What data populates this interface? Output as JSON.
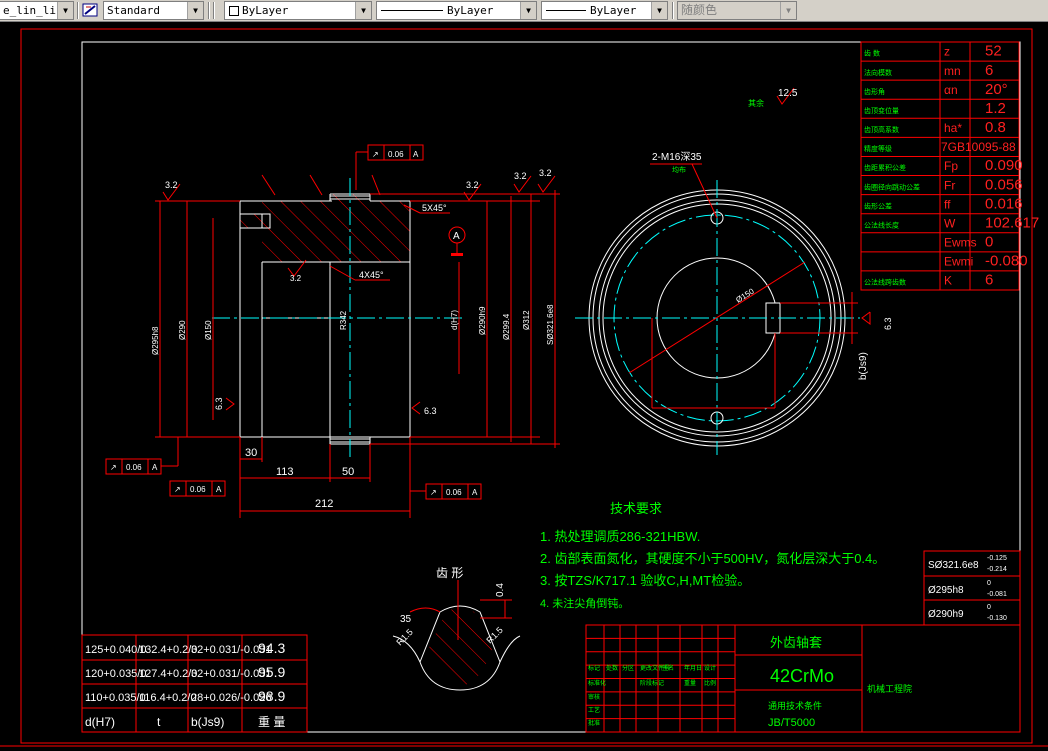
{
  "toolbar": {
    "layer_combo": "e_lin_lin",
    "textstyle_combo": "Standard",
    "color_combo": "ByLayer",
    "linetype_combo": "ByLayer",
    "lineweight_combo": "ByLayer",
    "plotstyle_combo": "随颜色"
  },
  "params": {
    "rows": [
      {
        "label": "齿    数",
        "sym": "z",
        "val": "52"
      },
      {
        "label": "法向模数",
        "sym": "mn",
        "val": "6"
      },
      {
        "label": "齿形角",
        "sym": "αn",
        "val": "20°"
      },
      {
        "label": "齿顶变位量",
        "sym": "",
        "val": "1.2"
      },
      {
        "label": "齿顶高系数",
        "sym": "ha*",
        "val": "0.8"
      },
      {
        "label": "精度等级",
        "sym": "",
        "val": "7GB10095-88"
      },
      {
        "label": "齿距累积公差",
        "sym": "Fp",
        "val": "0.090"
      },
      {
        "label": "齿圈径向跳动公差",
        "sym": "Fr",
        "val": "0.056"
      },
      {
        "label": "齿形公差",
        "sym": "ff",
        "val": "0.016"
      },
      {
        "label": "公法线长度",
        "sym": "W",
        "val": "102.617"
      },
      {
        "label": "",
        "sym": "Ewms",
        "val": "0"
      },
      {
        "label": "",
        "sym": "Ewmi",
        "val": "-0.080"
      },
      {
        "label": "公法线跨齿数",
        "sym": "K",
        "val": "6"
      }
    ]
  },
  "tech": {
    "title": "技术要求",
    "items": [
      "1. 热处理调质286-321HBW.",
      "2. 齿部表面氮化，其硬度不小于500HV，氮化层深大于0.4。",
      "3. 按TZS/K717.1 验收C,H,MT检验。",
      "4. 未注尖角倒钝。"
    ]
  },
  "dims": {
    "d_295": "Ø295h8",
    "d_290": "Ø290",
    "d_150": "Ø150",
    "d_290h9": "Ø290h9",
    "d_299": "Ø299.4",
    "d_312": "Ø312",
    "d_321": "SØ321.6e8",
    "d_ring": "Ø150",
    "r342": "R342",
    "d_h7": "d(H7)",
    "dim30": "30",
    "dim113": "113",
    "dim50": "50",
    "dim212": "212",
    "ch5": "5X45°",
    "ch4": "4X45°",
    "datum": "A",
    "thread": "2-M16深35",
    "thread_note": "均布",
    "b_js9": "b(Js9)",
    "rough": [
      "3.2",
      "3.2",
      "3.2",
      "3.2",
      "6.3",
      "6.3",
      "6.3",
      "12.5"
    ],
    "rough_note": "其余",
    "tol_sym": "↗",
    "tol_val": "0.06",
    "tol_ref": "A"
  },
  "fits": {
    "rows": [
      {
        "name": "SØ321.6e8",
        "up": "-0.125",
        "lo": "-0.214"
      },
      {
        "name": "Ø295h8",
        "up": "0",
        "lo": "-0.081"
      },
      {
        "name": "Ø290h9",
        "up": "0",
        "lo": "-0.130"
      }
    ]
  },
  "tooth": {
    "title": "齿 形",
    "r1": "R1.5",
    "r2": "R1.5",
    "a35": "35",
    "t04": "0.4"
  },
  "keyway_table": {
    "rows": [
      [
        "125+0.040/0",
        "132.4+0.2/0",
        "32+0.031/-0.031",
        "94.3"
      ],
      [
        "120+0.035/0",
        "127.4+0.2/0",
        "32+0.031/-0.031",
        "95.9"
      ],
      [
        "110+0.035/0",
        "116.4+0.2/0",
        "28+0.026/-0.026",
        "98.9"
      ]
    ],
    "footer": [
      "d(H7)",
      "t",
      "b(Js9)",
      "重    量"
    ]
  },
  "title_block": {
    "part_name": "外齿轴套",
    "material": "42CrMo",
    "spec_label": "通用技术条件",
    "spec": "JB/T5000",
    "company": "机械工程院",
    "small": [
      "标记",
      "处数",
      "分区",
      "更改文件号",
      "签名",
      "年月日",
      "设计",
      "标准化",
      "审核",
      "工艺",
      "批准",
      "阶段标记",
      "重量",
      "比例"
    ]
  }
}
